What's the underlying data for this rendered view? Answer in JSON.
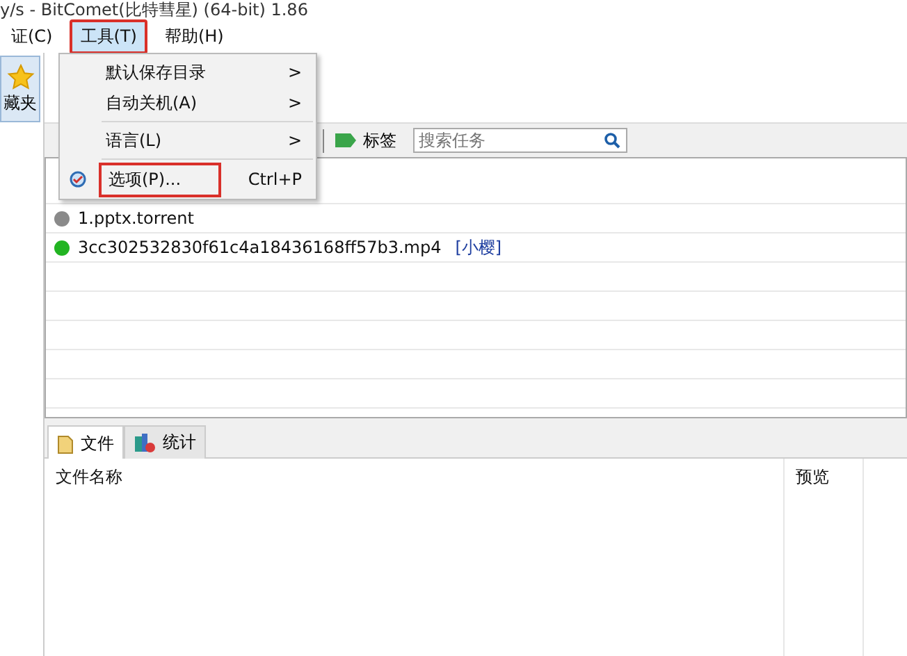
{
  "window": {
    "title": "y/s - BitComet(比特彗星) (64-bit) 1.86"
  },
  "menubar": [
    {
      "label": "证(C)",
      "selected": false,
      "highlighted": false
    },
    {
      "label": "工具(T)",
      "selected": true,
      "highlighted": true
    },
    {
      "label": "帮助(H)",
      "selected": false,
      "highlighted": false
    }
  ],
  "sidebar": {
    "items": [
      {
        "label": "藏夹"
      }
    ]
  },
  "task_toolbar": {
    "tag_button": "标签",
    "search": {
      "placeholder": "搜索任务"
    }
  },
  "tasks": [
    {
      "name": "1.pptx.torrent",
      "color": "#8a8a8a"
    },
    {
      "name": "3cc302532830f61c4a18436168ff57b3.mp4",
      "color": "#22b422",
      "tag": "[小樱]"
    }
  ],
  "bottom_tabs": [
    {
      "label": "文件",
      "selected": true
    },
    {
      "label": "统计",
      "selected": false
    }
  ],
  "files_table": {
    "columns": [
      "文件名称",
      "预览"
    ]
  },
  "menu": {
    "items": [
      {
        "kind": "submenu",
        "label": "默认保存目录",
        "arrow": ">"
      },
      {
        "kind": "submenu",
        "label": "自动关机(A)",
        "arrow": ">"
      },
      {
        "kind": "separator"
      },
      {
        "kind": "submenu",
        "label": "语言(L)",
        "arrow": ">"
      },
      {
        "kind": "separator"
      },
      {
        "kind": "command",
        "label": "选项(P)...",
        "shortcut": "Ctrl+P",
        "highlighted": true
      }
    ]
  }
}
